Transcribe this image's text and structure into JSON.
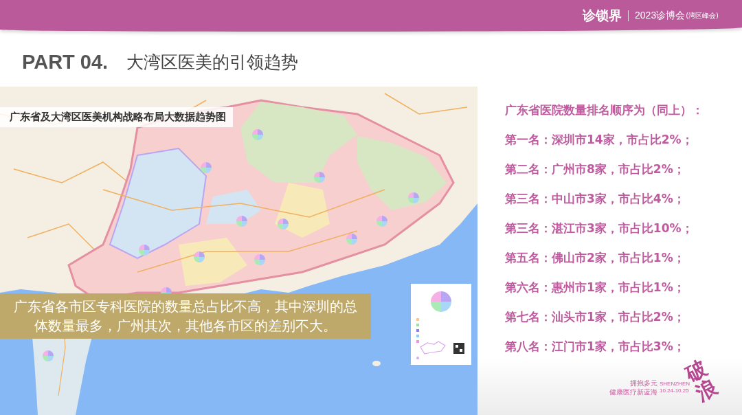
{
  "header": {
    "logo": "诊锁界",
    "event_title": "2023诊博会",
    "event_subtitle": "(湾区峰会)"
  },
  "title": {
    "part": "PART 04.",
    "heading": "大湾区医美的引领趋势"
  },
  "map": {
    "title": "广东省及大湾区医美机构战略布局大数据趋势图",
    "caption": "广东省各市区专科医院的数量总占比不高，其中深圳的总体数量最多，广州其次，其他各市区的差别不大。"
  },
  "ranking": {
    "heading": "广东省医院数量排名顺序为（同上）：",
    "items": [
      "第一名：深圳市14家，市占比2%；",
      "第二名：广州市8家，市占比2%；",
      "第三名：中山市3家，市占比4%；",
      "第三名：湛江市3家，市占比10%；",
      "第五名：佛山市2家，市占比1%；",
      "第六名：惠州市1家，市占比1%；",
      "第七名：汕头市1家，市占比2%；",
      "第八名：江门市1家，市占比3%；"
    ]
  },
  "branding": {
    "mark": "破浪",
    "slogan_lines": [
      "拥抱多元",
      "健康医疗新蓝海"
    ],
    "city": "SHENZHEN",
    "dates": "10.24-10.25"
  }
}
